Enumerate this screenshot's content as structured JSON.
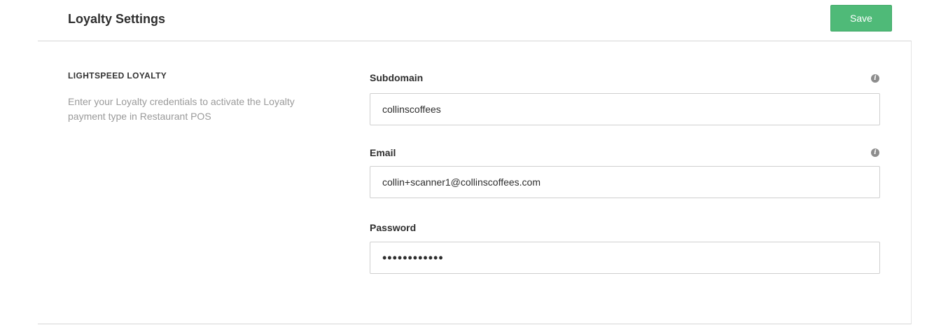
{
  "header": {
    "title": "Loyalty Settings",
    "save_label": "Save"
  },
  "section": {
    "heading": "LIGHTSPEED LOYALTY",
    "description": "Enter your Loyalty credentials to activate the Loyalty payment type in Restaurant POS"
  },
  "fields": {
    "subdomain": {
      "label": "Subdomain",
      "value": "collinscoffees",
      "info_icon": "info-icon"
    },
    "email": {
      "label": "Email",
      "value": "collin+scanner1@collinscoffees.com",
      "info_icon": "info-icon"
    },
    "password": {
      "label": "Password",
      "value": "••••••••••••"
    }
  },
  "colors": {
    "save_button": "#4fba78",
    "description_text": "#9a9a9a",
    "border": "#cfcfcf"
  }
}
